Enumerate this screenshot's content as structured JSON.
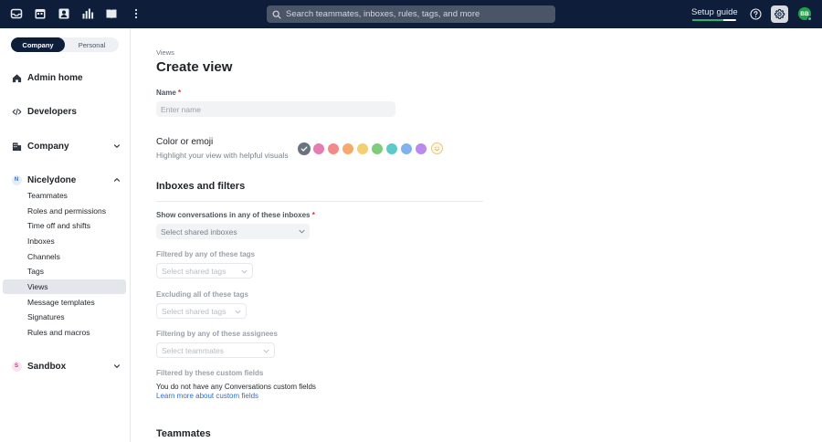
{
  "topbar": {
    "search_placeholder": "Search teammates, inboxes, rules, tags, and more",
    "setup_guide_label": "Setup guide",
    "setup_progress": 0.7,
    "avatar_initials": "BB"
  },
  "sidebar": {
    "toggle": {
      "active": "Company",
      "inactive": "Personal"
    },
    "sections": {
      "admin_home": "Admin home",
      "developers": "Developers",
      "company": "Company",
      "workspace": {
        "label": "Nicelydone",
        "badge": "N"
      },
      "sandbox": {
        "label": "Sandbox",
        "badge": "S"
      }
    },
    "workspace_items": [
      "Teammates",
      "Roles and permissions",
      "Time off and shifts",
      "Inboxes",
      "Channels",
      "Tags",
      "Views",
      "Message templates",
      "Signatures",
      "Rules and macros"
    ],
    "active_item": "Views"
  },
  "main": {
    "breadcrumb": "Views",
    "title": "Create view",
    "name_label": "Name",
    "required_mark": "*",
    "name_placeholder": "Enter name",
    "color_label": "Color or emoji",
    "color_hint": "Highlight your view with helpful visuals",
    "swatch_colors": [
      "#6b7280",
      "#e47db3",
      "#f28a8a",
      "#f4aa6c",
      "#f3cf72",
      "#80cc7e",
      "#5ec9c9",
      "#7fb2ef",
      "#b98af0"
    ],
    "inboxes_heading": "Inboxes and filters",
    "inboxes_label": "Show conversations in any of these inboxes",
    "inboxes_placeholder": "Select shared inboxes",
    "tags_label": "Filtered by any of these tags",
    "tags_placeholder": "Select shared tags",
    "exclude_label": "Excluding all of these tags",
    "exclude_placeholder": "Select shared tags",
    "assignees_label": "Filtering by any of these assignees",
    "assignees_placeholder": "Select teammates",
    "custom_fields_label": "Filtered by these custom fields",
    "custom_fields_note": "You do not have any Conversations custom fields",
    "custom_fields_link": "Learn more about custom fields",
    "teammates_heading": "Teammates"
  },
  "colors": {
    "topbar_bg": "#0e1e3a",
    "progress": "#2fb36a",
    "link": "#2a6fd6",
    "required": "#d0352e"
  }
}
